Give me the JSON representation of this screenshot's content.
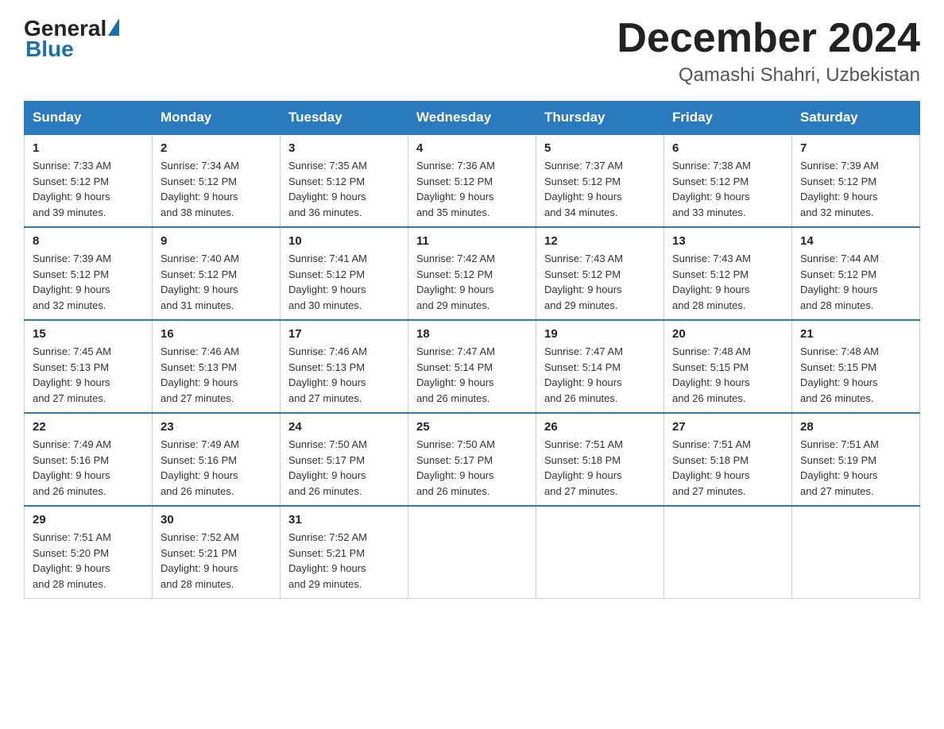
{
  "header": {
    "logo_general": "General",
    "logo_blue": "Blue",
    "title": "December 2024",
    "subtitle": "Qamashi Shahri, Uzbekistan"
  },
  "weekdays": [
    "Sunday",
    "Monday",
    "Tuesday",
    "Wednesday",
    "Thursday",
    "Friday",
    "Saturday"
  ],
  "weeks": [
    [
      {
        "day": "1",
        "sunrise": "7:33 AM",
        "sunset": "5:12 PM",
        "daylight": "9 hours and 39 minutes."
      },
      {
        "day": "2",
        "sunrise": "7:34 AM",
        "sunset": "5:12 PM",
        "daylight": "9 hours and 38 minutes."
      },
      {
        "day": "3",
        "sunrise": "7:35 AM",
        "sunset": "5:12 PM",
        "daylight": "9 hours and 36 minutes."
      },
      {
        "day": "4",
        "sunrise": "7:36 AM",
        "sunset": "5:12 PM",
        "daylight": "9 hours and 35 minutes."
      },
      {
        "day": "5",
        "sunrise": "7:37 AM",
        "sunset": "5:12 PM",
        "daylight": "9 hours and 34 minutes."
      },
      {
        "day": "6",
        "sunrise": "7:38 AM",
        "sunset": "5:12 PM",
        "daylight": "9 hours and 33 minutes."
      },
      {
        "day": "7",
        "sunrise": "7:39 AM",
        "sunset": "5:12 PM",
        "daylight": "9 hours and 32 minutes."
      }
    ],
    [
      {
        "day": "8",
        "sunrise": "7:39 AM",
        "sunset": "5:12 PM",
        "daylight": "9 hours and 32 minutes."
      },
      {
        "day": "9",
        "sunrise": "7:40 AM",
        "sunset": "5:12 PM",
        "daylight": "9 hours and 31 minutes."
      },
      {
        "day": "10",
        "sunrise": "7:41 AM",
        "sunset": "5:12 PM",
        "daylight": "9 hours and 30 minutes."
      },
      {
        "day": "11",
        "sunrise": "7:42 AM",
        "sunset": "5:12 PM",
        "daylight": "9 hours and 29 minutes."
      },
      {
        "day": "12",
        "sunrise": "7:43 AM",
        "sunset": "5:12 PM",
        "daylight": "9 hours and 29 minutes."
      },
      {
        "day": "13",
        "sunrise": "7:43 AM",
        "sunset": "5:12 PM",
        "daylight": "9 hours and 28 minutes."
      },
      {
        "day": "14",
        "sunrise": "7:44 AM",
        "sunset": "5:12 PM",
        "daylight": "9 hours and 28 minutes."
      }
    ],
    [
      {
        "day": "15",
        "sunrise": "7:45 AM",
        "sunset": "5:13 PM",
        "daylight": "9 hours and 27 minutes."
      },
      {
        "day": "16",
        "sunrise": "7:46 AM",
        "sunset": "5:13 PM",
        "daylight": "9 hours and 27 minutes."
      },
      {
        "day": "17",
        "sunrise": "7:46 AM",
        "sunset": "5:13 PM",
        "daylight": "9 hours and 27 minutes."
      },
      {
        "day": "18",
        "sunrise": "7:47 AM",
        "sunset": "5:14 PM",
        "daylight": "9 hours and 26 minutes."
      },
      {
        "day": "19",
        "sunrise": "7:47 AM",
        "sunset": "5:14 PM",
        "daylight": "9 hours and 26 minutes."
      },
      {
        "day": "20",
        "sunrise": "7:48 AM",
        "sunset": "5:15 PM",
        "daylight": "9 hours and 26 minutes."
      },
      {
        "day": "21",
        "sunrise": "7:48 AM",
        "sunset": "5:15 PM",
        "daylight": "9 hours and 26 minutes."
      }
    ],
    [
      {
        "day": "22",
        "sunrise": "7:49 AM",
        "sunset": "5:16 PM",
        "daylight": "9 hours and 26 minutes."
      },
      {
        "day": "23",
        "sunrise": "7:49 AM",
        "sunset": "5:16 PM",
        "daylight": "9 hours and 26 minutes."
      },
      {
        "day": "24",
        "sunrise": "7:50 AM",
        "sunset": "5:17 PM",
        "daylight": "9 hours and 26 minutes."
      },
      {
        "day": "25",
        "sunrise": "7:50 AM",
        "sunset": "5:17 PM",
        "daylight": "9 hours and 26 minutes."
      },
      {
        "day": "26",
        "sunrise": "7:51 AM",
        "sunset": "5:18 PM",
        "daylight": "9 hours and 27 minutes."
      },
      {
        "day": "27",
        "sunrise": "7:51 AM",
        "sunset": "5:18 PM",
        "daylight": "9 hours and 27 minutes."
      },
      {
        "day": "28",
        "sunrise": "7:51 AM",
        "sunset": "5:19 PM",
        "daylight": "9 hours and 27 minutes."
      }
    ],
    [
      {
        "day": "29",
        "sunrise": "7:51 AM",
        "sunset": "5:20 PM",
        "daylight": "9 hours and 28 minutes."
      },
      {
        "day": "30",
        "sunrise": "7:52 AM",
        "sunset": "5:21 PM",
        "daylight": "9 hours and 28 minutes."
      },
      {
        "day": "31",
        "sunrise": "7:52 AM",
        "sunset": "5:21 PM",
        "daylight": "9 hours and 29 minutes."
      },
      null,
      null,
      null,
      null
    ]
  ],
  "labels": {
    "sunrise": "Sunrise:",
    "sunset": "Sunset:",
    "daylight": "Daylight:"
  }
}
